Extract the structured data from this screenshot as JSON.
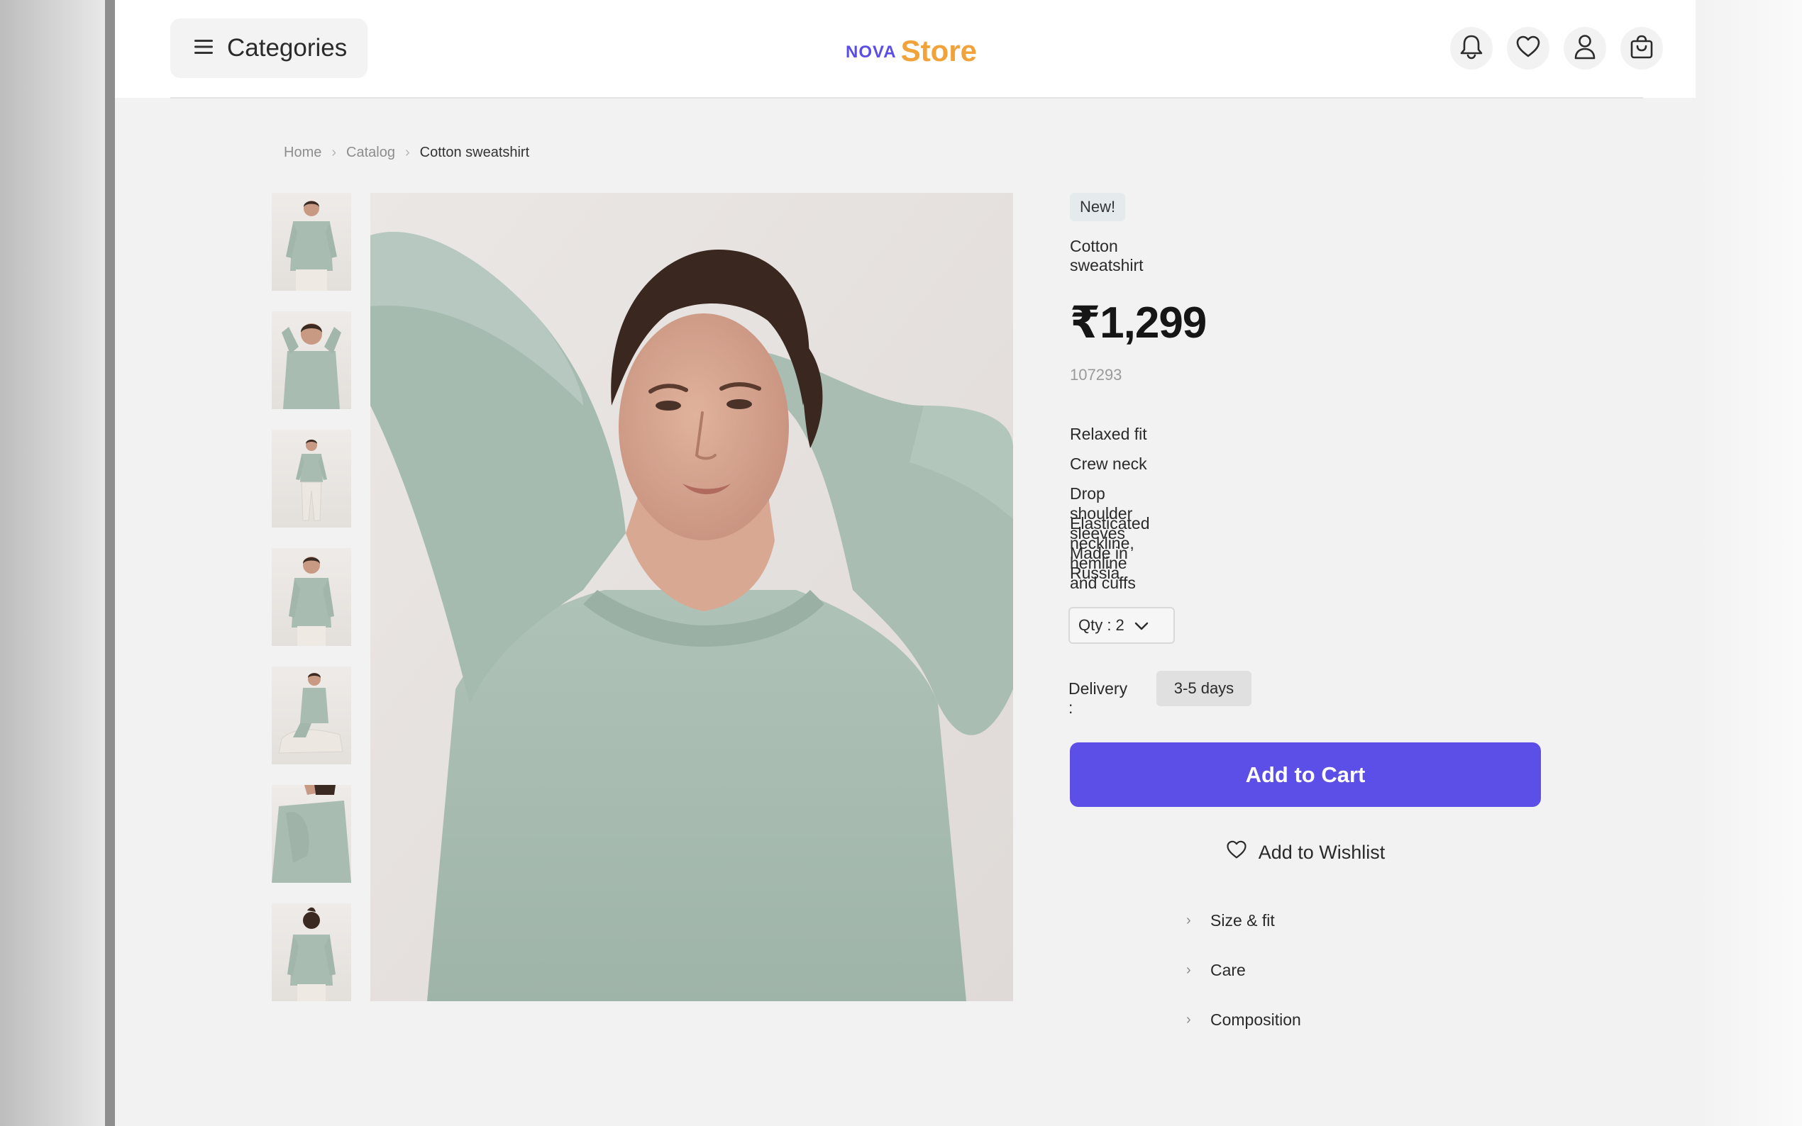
{
  "header": {
    "categories_label": "Categories",
    "logo_prefix": "NOVA",
    "logo_main": "Store",
    "icons": [
      "bell-icon",
      "heart-icon",
      "user-icon",
      "shopping-bag-icon"
    ]
  },
  "breadcrumb": [
    "Home",
    "Catalog",
    "Cotton sweatshirt"
  ],
  "product": {
    "badge": "New!",
    "title": "Cotton sweatshirt",
    "price": "₹1,299",
    "sku": "107293",
    "features": [
      "Relaxed fit",
      "Crew neck",
      "Drop shoulder sleeves",
      "Elasticated neckline, hemline and cuffs",
      "Made in Russia"
    ],
    "quantity_label": "Qty : 2",
    "delivery_label": "Delivery :",
    "delivery_value": "3-5 days",
    "add_to_cart": "Add to Cart",
    "add_to_wishlist": "Add to Wishlist",
    "accordions": [
      "Size & fit",
      "Care",
      "Composition"
    ]
  },
  "colors": {
    "accent": "#5b4fe8",
    "logo_prefix": "#5a4ee6",
    "logo_main": "#f2a23a",
    "sweatshirt": "#a8bcb2"
  }
}
